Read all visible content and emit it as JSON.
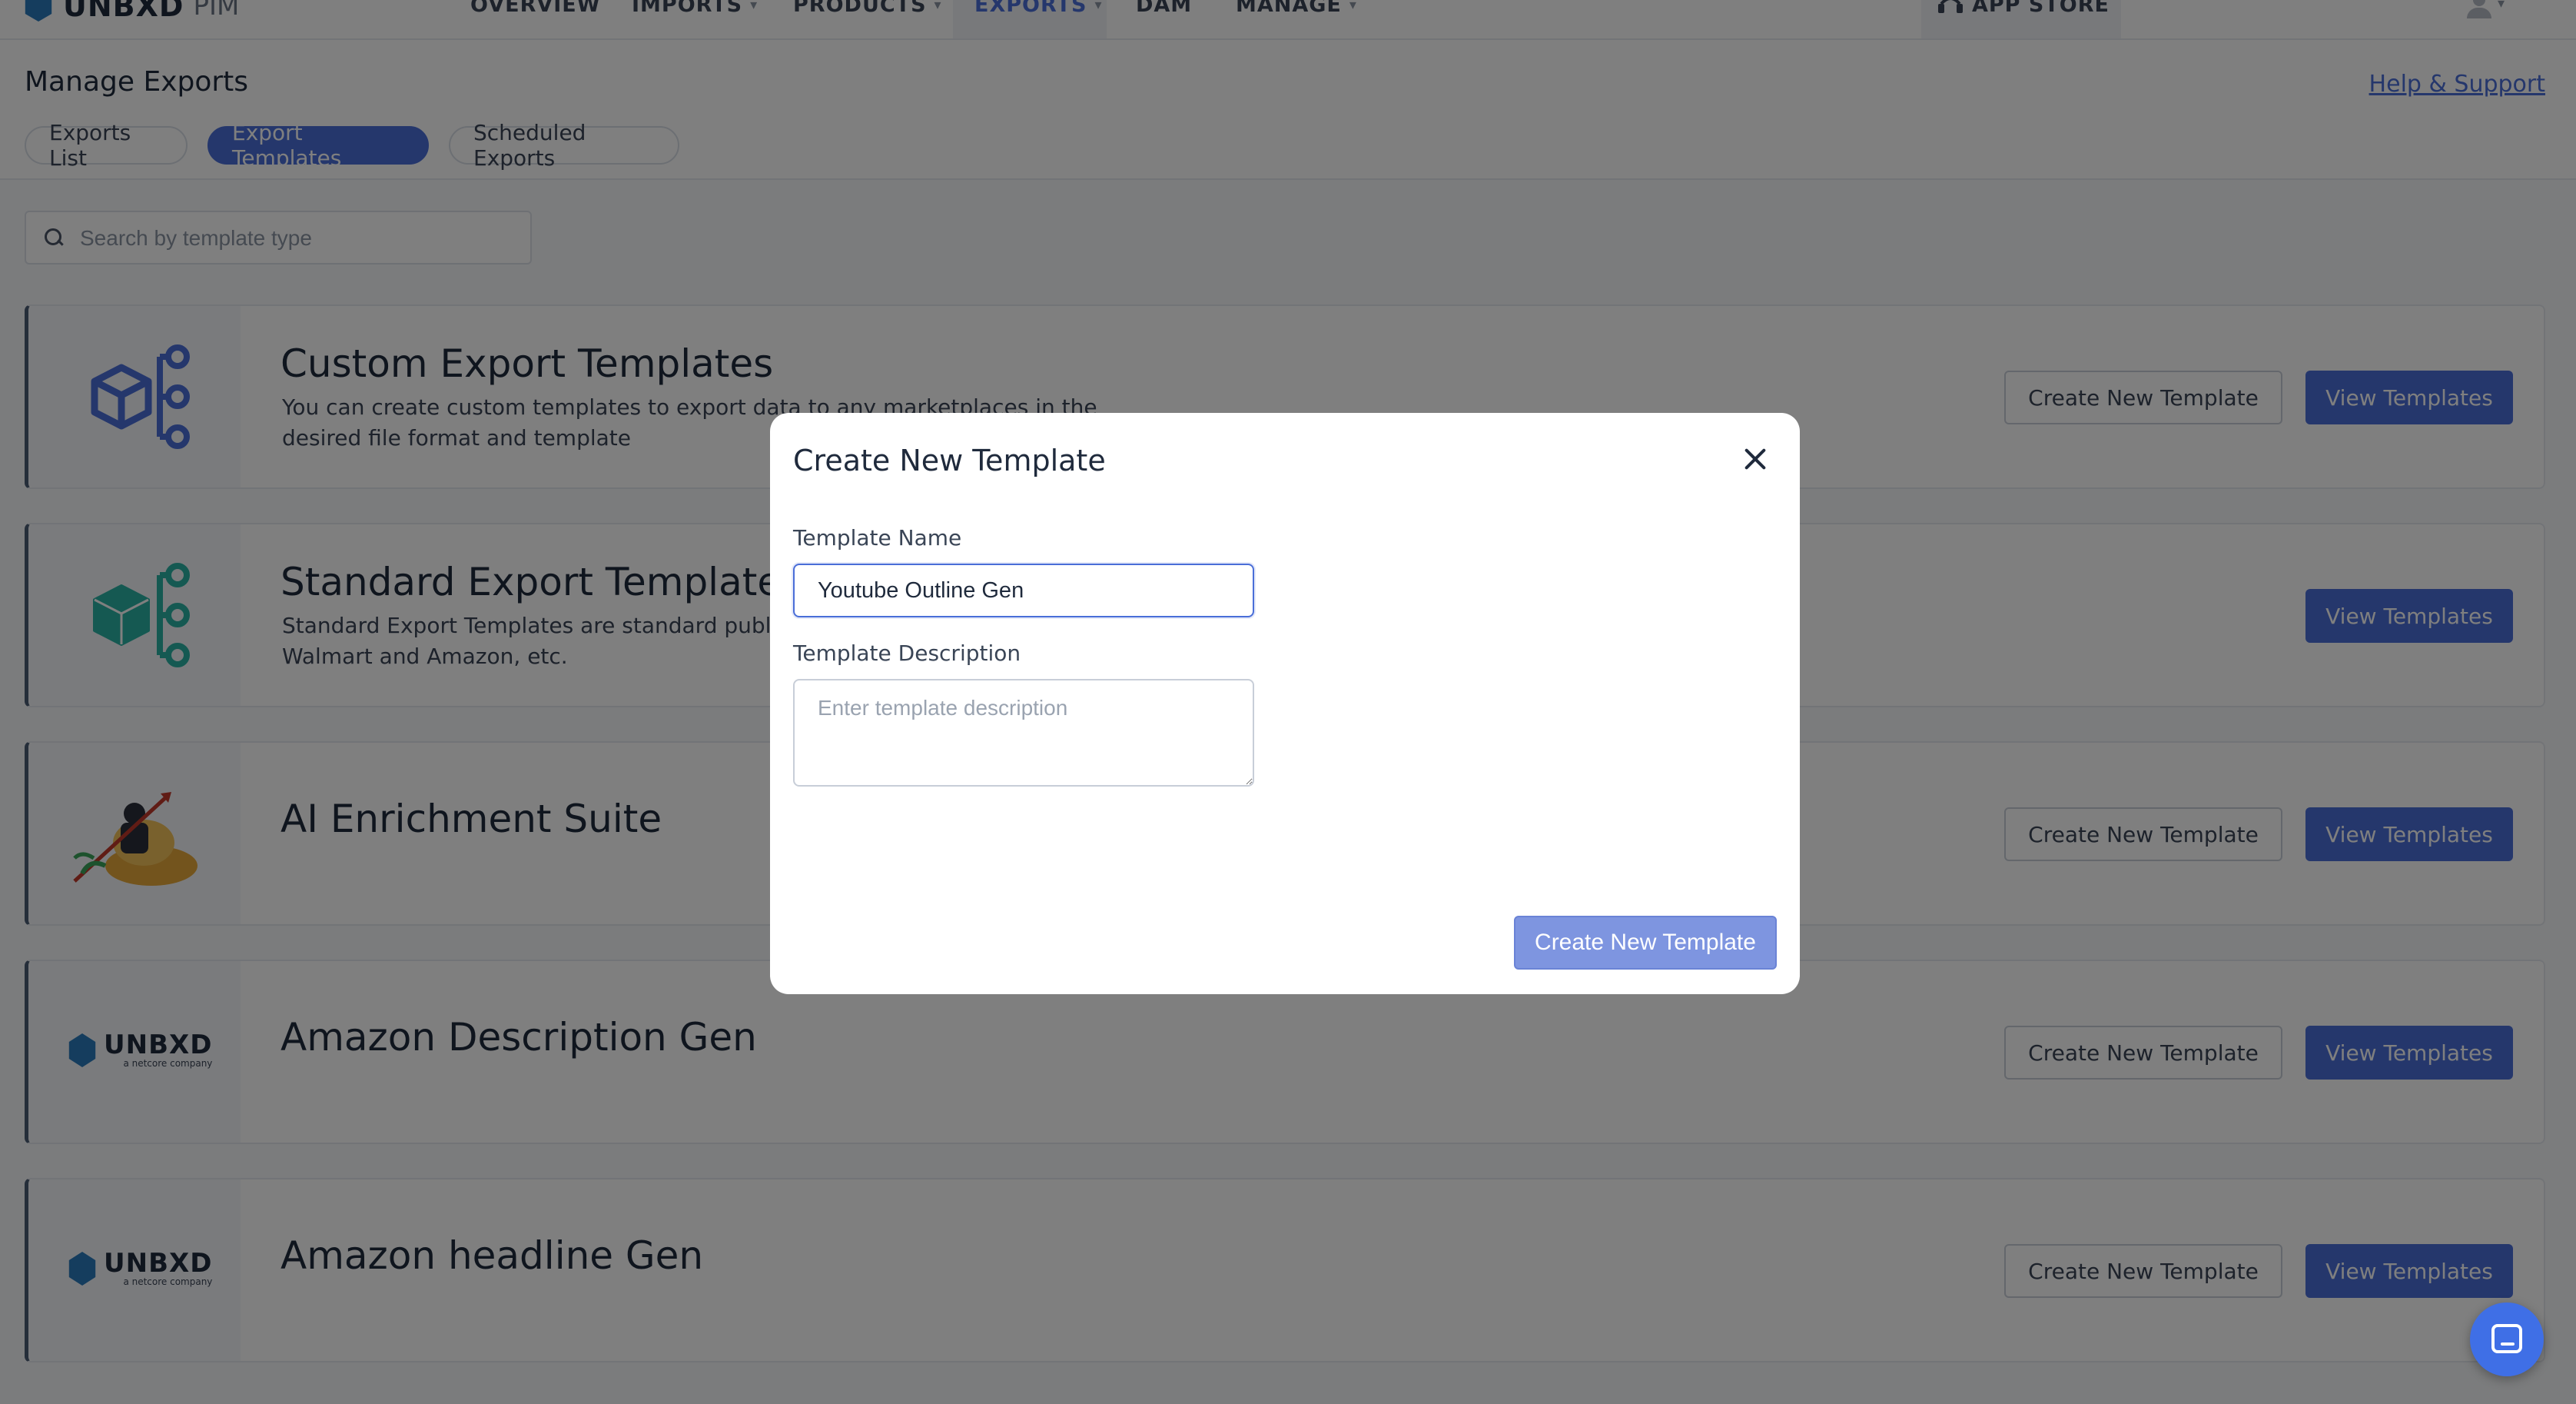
{
  "brand": {
    "name": "UNBXD",
    "suffix": "PIM"
  },
  "nav": {
    "items": [
      {
        "label": "OVERVIEW",
        "has_dropdown": false
      },
      {
        "label": "IMPORTS",
        "has_dropdown": true
      },
      {
        "label": "PRODUCTS",
        "has_dropdown": true
      },
      {
        "label": "EXPORTS",
        "has_dropdown": true,
        "active": true
      },
      {
        "label": "DAM",
        "has_dropdown": false
      },
      {
        "label": "MANAGE",
        "has_dropdown": true
      }
    ],
    "app_store": "APP STORE"
  },
  "page": {
    "title": "Manage Exports",
    "help_link": "Help & Support",
    "tabs": [
      {
        "label": "Exports List",
        "active": false
      },
      {
        "label": "Export Templates",
        "active": true
      },
      {
        "label": "Scheduled Exports",
        "active": false
      }
    ],
    "search_placeholder": "Search by template type"
  },
  "cards": [
    {
      "title": "Custom Export Templates",
      "description": "You can create custom templates to export data to any marketplaces in the desired file format and template",
      "icon": "cube-tree-icon",
      "create_label": "Create New Template",
      "view_label": "View Templates"
    },
    {
      "title": "Standard Export Templates",
      "description": "Standard Export Templates are standard publically available templates for Walmart and Amazon, etc.",
      "icon": "cube-tree-icon",
      "view_label": "View Templates"
    },
    {
      "title": "AI Enrichment Suite",
      "icon": "ai-enrichment-illustration",
      "create_label": "Create New Template",
      "view_label": "View Templates"
    },
    {
      "title": "Amazon Description Gen",
      "icon": "unbxd-logo",
      "logo_text": "UNBXD",
      "logo_sub": "a netcore company",
      "create_label": "Create New Template",
      "view_label": "View Templates"
    },
    {
      "title": "Amazon headline Gen",
      "icon": "unbxd-logo",
      "logo_text": "UNBXD",
      "logo_sub": "a netcore company",
      "create_label": "Create New Template",
      "view_label": "View Templates"
    }
  ],
  "modal": {
    "title": "Create New Template",
    "name_label": "Template Name",
    "name_value": "Youtube Outline Gen",
    "description_label": "Template Description",
    "description_placeholder": "Enter template description",
    "submit_label": "Create New Template"
  },
  "colors": {
    "accent": "#4a6ed8",
    "overlay": "rgba(0,0,0,0.5)"
  }
}
